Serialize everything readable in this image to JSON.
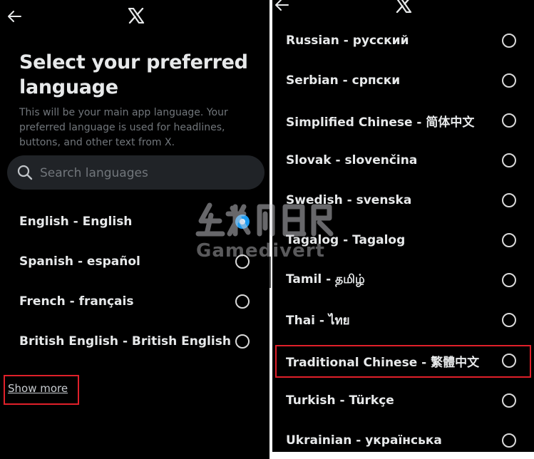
{
  "left": {
    "title": "Select your preferred language",
    "subtitle": "This will be your main app language. Your preferred language is used for headlines, buttons, and other text from X.",
    "search": {
      "placeholder": "Search languages"
    },
    "languages": [
      {
        "label": "English - English",
        "selected": true
      },
      {
        "label": "Spanish - español",
        "selected": false
      },
      {
        "label": "French - français",
        "selected": false
      },
      {
        "label": "British English - British English",
        "selected": false
      }
    ],
    "show_more": "Show more"
  },
  "right": {
    "languages": [
      {
        "label": "Russian - русский",
        "selected": false
      },
      {
        "label": "Serbian - српски",
        "selected": false
      },
      {
        "label": "Simplified Chinese - 简体中文",
        "selected": false
      },
      {
        "label": "Slovak - slovenčina",
        "selected": false
      },
      {
        "label": "Swedish - svenska",
        "selected": false
      },
      {
        "label": "Tagalog - Tagalog",
        "selected": false
      },
      {
        "label": "Tamil - தமிழ்",
        "selected": false
      },
      {
        "label": "Thai - ไทย",
        "selected": false
      },
      {
        "label": "Traditional Chinese - 繁體中文",
        "selected": false
      },
      {
        "label": "Turkish - Türkçe",
        "selected": false
      },
      {
        "label": "Ukrainian - українська",
        "selected": false
      }
    ]
  },
  "watermark": {
    "text": "Gamedivert"
  },
  "colors": {
    "background": "#000000",
    "text": "#e7e9ea",
    "muted": "#71767b",
    "accent": "#1d9bf0",
    "highlight": "#e0202a"
  },
  "icons": [
    "back-arrow-icon",
    "x-logo-icon",
    "search-icon"
  ]
}
